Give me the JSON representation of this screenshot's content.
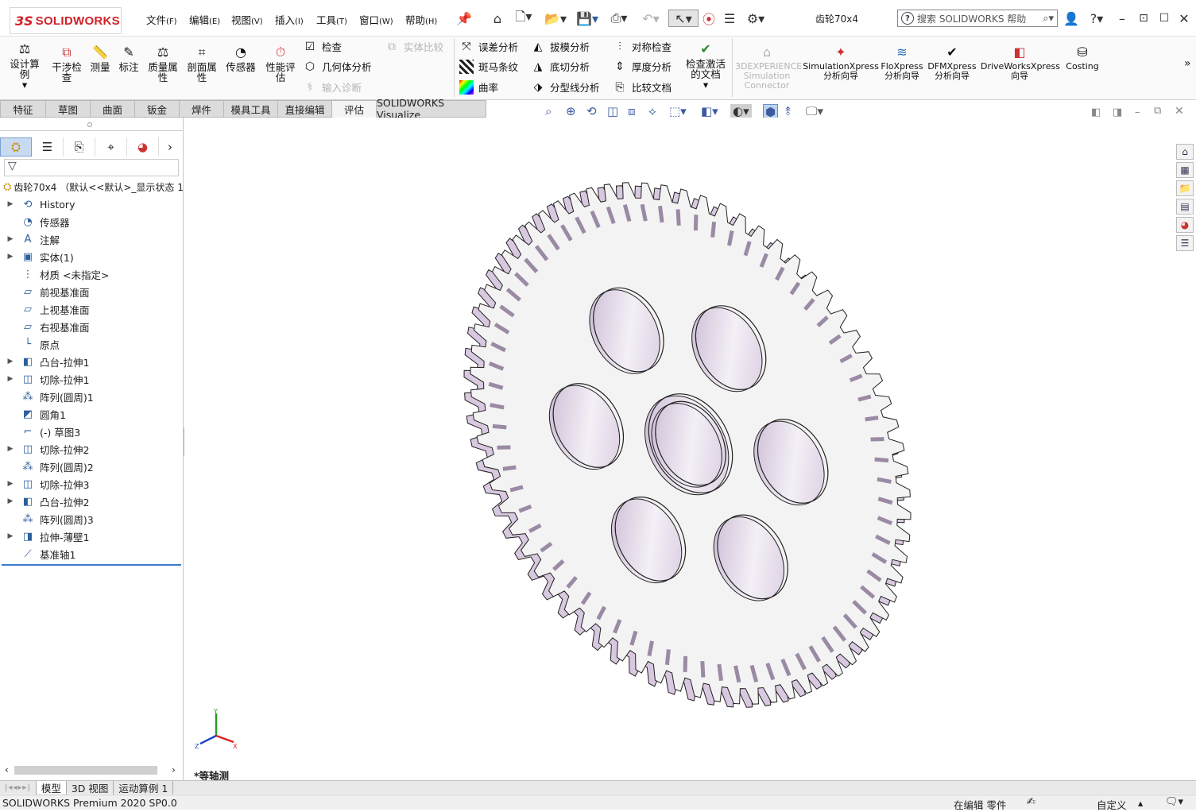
{
  "app": {
    "logo_ds": "3S",
    "logo_text": "SOLIDWORKS",
    "doc_title": "齿轮70x4"
  },
  "menu": [
    {
      "label": "文件",
      "key": "(F)"
    },
    {
      "label": "编辑",
      "key": "(E)"
    },
    {
      "label": "视图",
      "key": "(V)"
    },
    {
      "label": "插入",
      "key": "(I)"
    },
    {
      "label": "工具",
      "key": "(T)"
    },
    {
      "label": "窗口",
      "key": "(W)"
    },
    {
      "label": "帮助",
      "key": "(H)"
    }
  ],
  "search": {
    "placeholder": "搜索 SOLIDWORKS 帮助"
  },
  "ribbon": {
    "design_study": "设计算例",
    "interference": "干涉检查",
    "measure": "测量",
    "markup": "标注",
    "mass_props": "质量属性",
    "section_props": "剖面属性",
    "sensor": "传感器",
    "perf_eval": "性能评估",
    "check": "检查",
    "geometry_analysis": "几何体分析",
    "import_diag": "输入诊断",
    "body_compare": "实体比较",
    "deviation": "误差分析",
    "zebra": "斑马条纹",
    "curvature": "曲率",
    "draft": "拔模分析",
    "undercut": "底切分析",
    "parting": "分型线分析",
    "symmetry": "对称检查",
    "thickness": "厚度分析",
    "compare_docs": "比较文档",
    "check_active": "检查激活的文档",
    "exp_connector": "3DEXPERIENCE Simulation Connector",
    "simxpress": "SimulationXpress 分析向导",
    "floxpress": "FloXpress 分析向导",
    "dfmxpress": "DFMXpress 分析向导",
    "driveworks": "DriveWorksXpress 向导",
    "costing": "Costing"
  },
  "tabs": [
    "特征",
    "草图",
    "曲面",
    "钣金",
    "焊件",
    "模具工具",
    "直接编辑",
    "评估",
    "SOLIDWORKS Visualize"
  ],
  "active_tab": "评估",
  "tree": {
    "root": "齿轮70x4 （默认<<默认>_显示状态 1",
    "items": [
      {
        "label": "History",
        "icon": "history-icon",
        "expand": true
      },
      {
        "label": "传感器",
        "icon": "sensor-icon",
        "expand": false
      },
      {
        "label": "注解",
        "icon": "annotation-icon",
        "expand": true
      },
      {
        "label": "实体(1)",
        "icon": "solid-bodies-icon",
        "expand": true
      },
      {
        "label": "材质 <未指定>",
        "icon": "material-icon",
        "expand": false
      },
      {
        "label": "前视基准面",
        "icon": "plane-icon",
        "expand": false
      },
      {
        "label": "上视基准面",
        "icon": "plane-icon",
        "expand": false
      },
      {
        "label": "右视基准面",
        "icon": "plane-icon",
        "expand": false
      },
      {
        "label": "原点",
        "icon": "origin-icon",
        "expand": false
      },
      {
        "label": "凸台-拉伸1",
        "icon": "boss-extrude-icon",
        "expand": true
      },
      {
        "label": "切除-拉伸1",
        "icon": "cut-extrude-icon",
        "expand": true
      },
      {
        "label": "阵列(圆周)1",
        "icon": "circular-pattern-icon",
        "expand": false
      },
      {
        "label": "圆角1",
        "icon": "fillet-icon",
        "expand": false
      },
      {
        "label": "(-) 草图3",
        "icon": "sketch-icon",
        "expand": false
      },
      {
        "label": "切除-拉伸2",
        "icon": "cut-extrude-icon",
        "expand": true
      },
      {
        "label": "阵列(圆周)2",
        "icon": "circular-pattern-icon",
        "expand": false
      },
      {
        "label": "切除-拉伸3",
        "icon": "cut-extrude-icon",
        "expand": true
      },
      {
        "label": "凸台-拉伸2",
        "icon": "boss-extrude-icon",
        "expand": true
      },
      {
        "label": "阵列(圆周)3",
        "icon": "circular-pattern-icon",
        "expand": false
      },
      {
        "label": "拉伸-薄壁1",
        "icon": "thin-extrude-icon",
        "expand": true
      },
      {
        "label": "基准轴1",
        "icon": "axis-icon",
        "expand": false
      }
    ]
  },
  "viewport": {
    "view_name": "*等轴测",
    "triad": {
      "x": "X",
      "y": "Y",
      "z": "Z"
    }
  },
  "bottom_tabs": [
    "模型",
    "3D 视图",
    "运动算例 1"
  ],
  "status": {
    "left": "SOLIDWORKS Premium 2020 SP0.0",
    "editing": "在编辑 零件",
    "units": "自定义"
  },
  "colors": {
    "accent": "#d32027",
    "gear_face": "#f3f3f3",
    "gear_shade": "#d8c8e0"
  }
}
